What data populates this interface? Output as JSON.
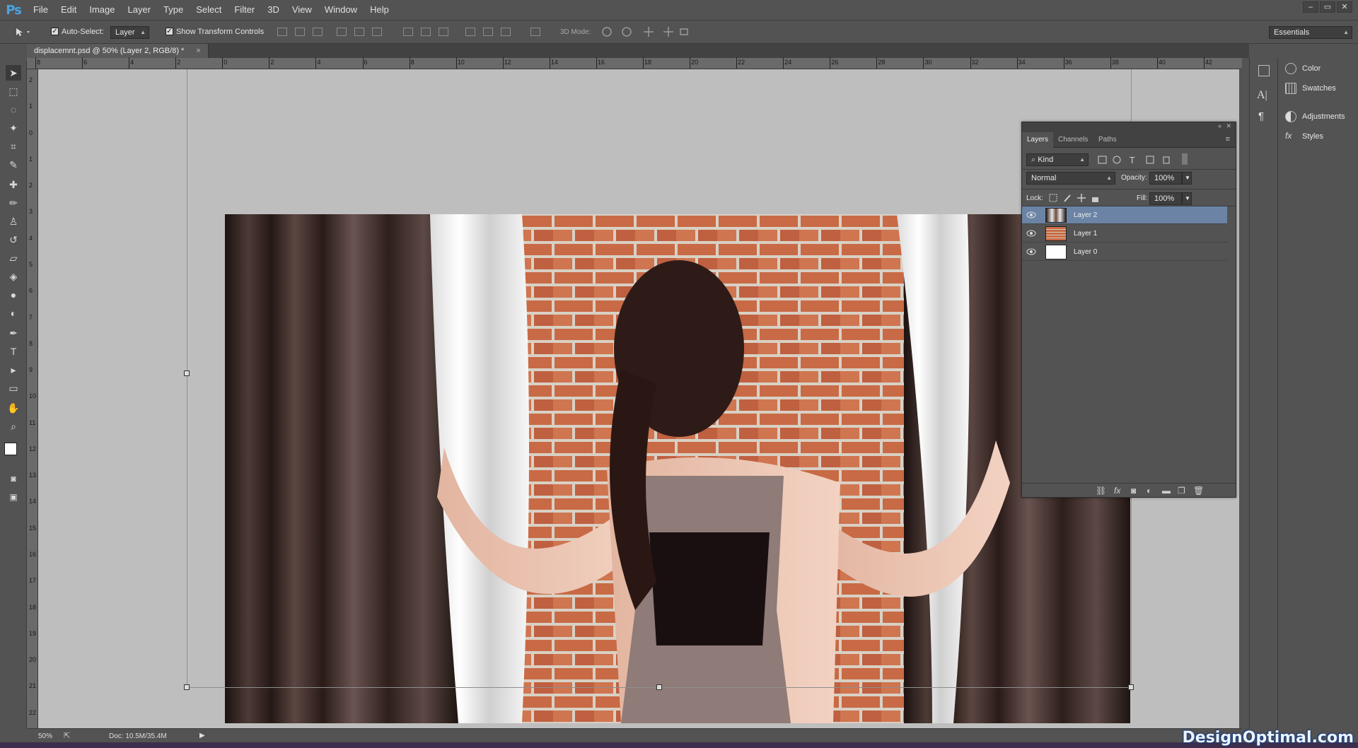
{
  "app": {
    "logo": "Ps",
    "menu": [
      "File",
      "Edit",
      "Image",
      "Layer",
      "Type",
      "Select",
      "Filter",
      "3D",
      "View",
      "Window",
      "Help"
    ],
    "window_controls": [
      "–",
      "▭",
      "✕"
    ]
  },
  "options_bar": {
    "auto_select_label": "Auto-Select:",
    "auto_select_value": "Layer",
    "transform_label": "Show Transform Controls",
    "mode_3d_label": "3D Mode:",
    "workspace": "Essentials"
  },
  "document": {
    "tab_title": "displacemnt.psd @ 50% (Layer 2, RGB/8) *",
    "zoom": "50%",
    "doc_size": "Doc: 10.5M/35.4M"
  },
  "ruler": {
    "top": [
      "8",
      "6",
      "4",
      "2",
      "0",
      "2",
      "4",
      "6",
      "8",
      "10",
      "12",
      "14",
      "16",
      "18",
      "20",
      "22",
      "24",
      "26",
      "28",
      "30",
      "32",
      "34",
      "36",
      "38",
      "40",
      "42"
    ],
    "left": [
      "2",
      "1",
      "0",
      "1",
      "2",
      "3",
      "4",
      "5",
      "6",
      "7",
      "8",
      "9",
      "10",
      "11",
      "12",
      "13",
      "14",
      "15",
      "16",
      "17",
      "18",
      "19",
      "20",
      "21",
      "22"
    ]
  },
  "layers_panel": {
    "tabs": [
      "Layers",
      "Channels",
      "Paths"
    ],
    "active_tab": "Layers",
    "filter_kind": "Kind",
    "blend_mode": "Normal",
    "opacity_label": "Opacity:",
    "opacity": "100%",
    "lock_label": "Lock:",
    "fill_label": "Fill:",
    "fill": "100%",
    "layers": [
      {
        "name": "Layer 2",
        "selected": true
      },
      {
        "name": "Layer 1",
        "selected": false
      },
      {
        "name": "Layer 0",
        "selected": false
      }
    ]
  },
  "dock": {
    "items": [
      "Color",
      "Swatches",
      "Adjustments",
      "Styles"
    ]
  },
  "watermark": "DesignOptimal.com"
}
